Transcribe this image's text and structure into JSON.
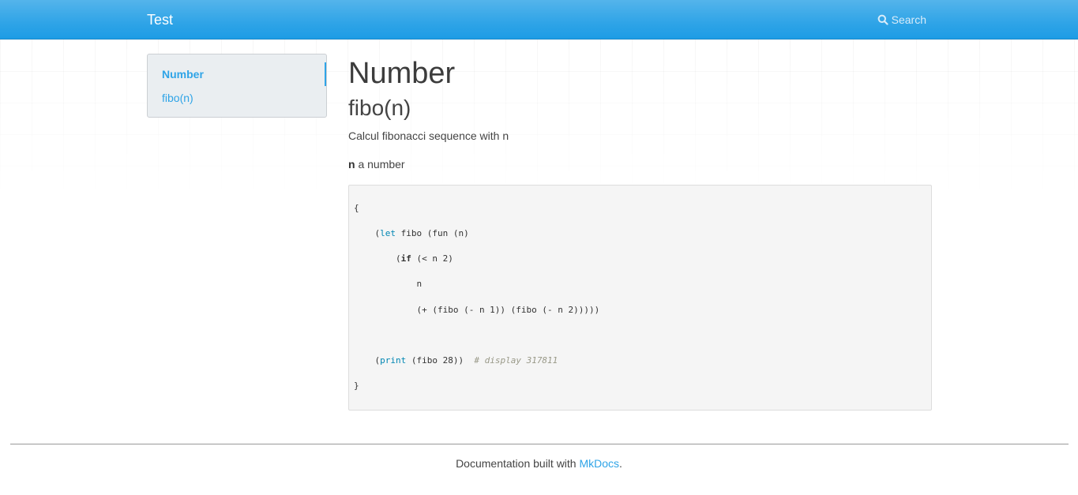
{
  "navbar": {
    "brand": "Test",
    "search_label": "Search",
    "search_icon": "search-icon"
  },
  "sidebar": {
    "items": [
      {
        "label": "Number",
        "active": true
      },
      {
        "label": "fibo(n)"
      }
    ]
  },
  "main": {
    "title": "Number",
    "subtitle": "fibo(n)",
    "description": "Calcul fibonacci sequence with n",
    "param_name": "n",
    "param_desc": " a number",
    "code": {
      "line1": "{",
      "line2_open": "    (",
      "line2_kw": "let",
      "line2_rest": " fibo (fun (n)",
      "line3_open": "        (",
      "line3_kw": "if",
      "line3_rest": " (< n 2)",
      "line4": "            n",
      "line5": "            (+ (fibo (- n 1)) (fibo (- n 2)))))",
      "line6_open": "    (",
      "line6_kw": "print",
      "line6_rest": " (fibo 28))  ",
      "line6_comment": "# display 317811",
      "line7": "}"
    }
  },
  "footer": {
    "text_before": "Documentation built with ",
    "link": "MkDocs",
    "text_after": "."
  },
  "colors": {
    "accent": "#2fa4e7",
    "navbar": "#2fa4e7",
    "code_bg": "#f5f5f5"
  }
}
